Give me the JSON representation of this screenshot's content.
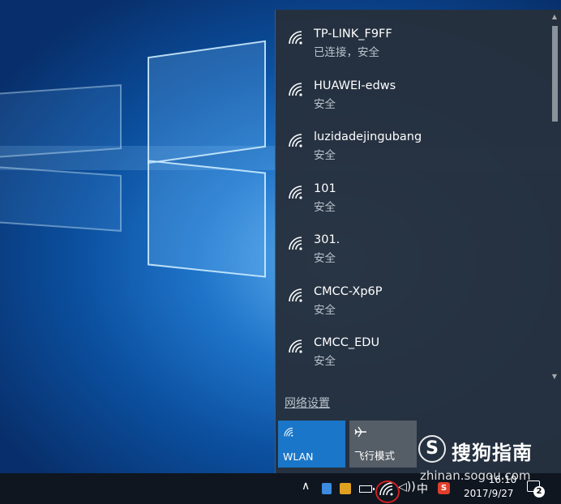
{
  "networks": [
    {
      "name": "TP-LINK_F9FF",
      "status": "已连接，安全"
    },
    {
      "name": "HUAWEI-edws",
      "status": "安全"
    },
    {
      "name": "luzidadejingubang",
      "status": "安全"
    },
    {
      "name": "101",
      "status": "安全"
    },
    {
      "name": "301.",
      "status": "安全"
    },
    {
      "name": "CMCC-Xp6P",
      "status": "安全"
    },
    {
      "name": "CMCC_EDU",
      "status": "安全"
    }
  ],
  "network_settings_link": "网络设置",
  "tiles": {
    "wlan": {
      "label": "WLAN",
      "icon": "wifi-icon",
      "active": true
    },
    "airplane": {
      "label": "飞行模式",
      "icon": "airplane-icon",
      "active": false
    }
  },
  "taskbar": {
    "ime_label": "中",
    "sogou_label": "S",
    "time": "16:10",
    "date": "2017/9/27",
    "notification_count": "2"
  },
  "watermark": {
    "logo_letter": "S",
    "brand": "搜狗指南",
    "url": "zhinan.sogou.com"
  },
  "colors": {
    "accent": "#1a76c8",
    "flyout_bg": "#26303c",
    "taskbar_bg": "#0f1620",
    "highlight_circle": "#d02020"
  }
}
